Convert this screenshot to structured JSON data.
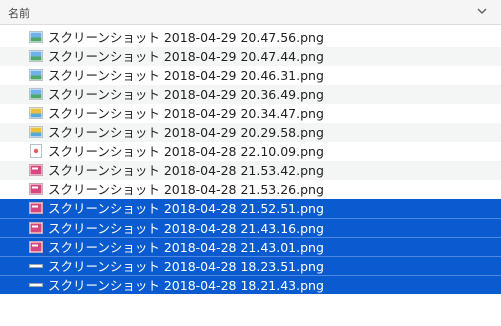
{
  "header": {
    "name_column_label": "名前"
  },
  "files": [
    {
      "name": "スクリーンショット 2018-04-29 20.47.56.png",
      "thumbnail": "landscape",
      "selected": false
    },
    {
      "name": "スクリーンショット 2018-04-29 20.47.44.png",
      "thumbnail": "landscape",
      "selected": false
    },
    {
      "name": "スクリーンショット 2018-04-29 20.46.31.png",
      "thumbnail": "landscape",
      "selected": false
    },
    {
      "name": "スクリーンショット 2018-04-29 20.36.49.png",
      "thumbnail": "landscape",
      "selected": false
    },
    {
      "name": "スクリーンショット 2018-04-29 20.34.47.png",
      "thumbnail": "landscape-yellow",
      "selected": false
    },
    {
      "name": "スクリーンショット 2018-04-29 20.29.58.png",
      "thumbnail": "landscape-yellow",
      "selected": false
    },
    {
      "name": "スクリーンショット 2018-04-28 22.10.09.png",
      "thumbnail": "document-red",
      "selected": false
    },
    {
      "name": "スクリーンショット 2018-04-28 21.53.42.png",
      "thumbnail": "pink",
      "selected": false
    },
    {
      "name": "スクリーンショット 2018-04-28 21.53.26.png",
      "thumbnail": "pink",
      "selected": false
    },
    {
      "name": "スクリーンショット 2018-04-28 21.52.51.png",
      "thumbnail": "pink",
      "selected": true
    },
    {
      "name": "スクリーンショット 2018-04-28 21.43.16.png",
      "thumbnail": "pink",
      "selected": true
    },
    {
      "name": "スクリーンショット 2018-04-28 21.43.01.png",
      "thumbnail": "pink",
      "selected": true
    },
    {
      "name": "スクリーンショット 2018-04-28 18.23.51.png",
      "thumbnail": "strip",
      "selected": true
    },
    {
      "name": "スクリーンショット 2018-04-28 18.21.43.png",
      "thumbnail": "strip",
      "selected": true
    }
  ],
  "colors": {
    "selection": "#0a5bcf",
    "stripe": "#f4f5f5"
  }
}
